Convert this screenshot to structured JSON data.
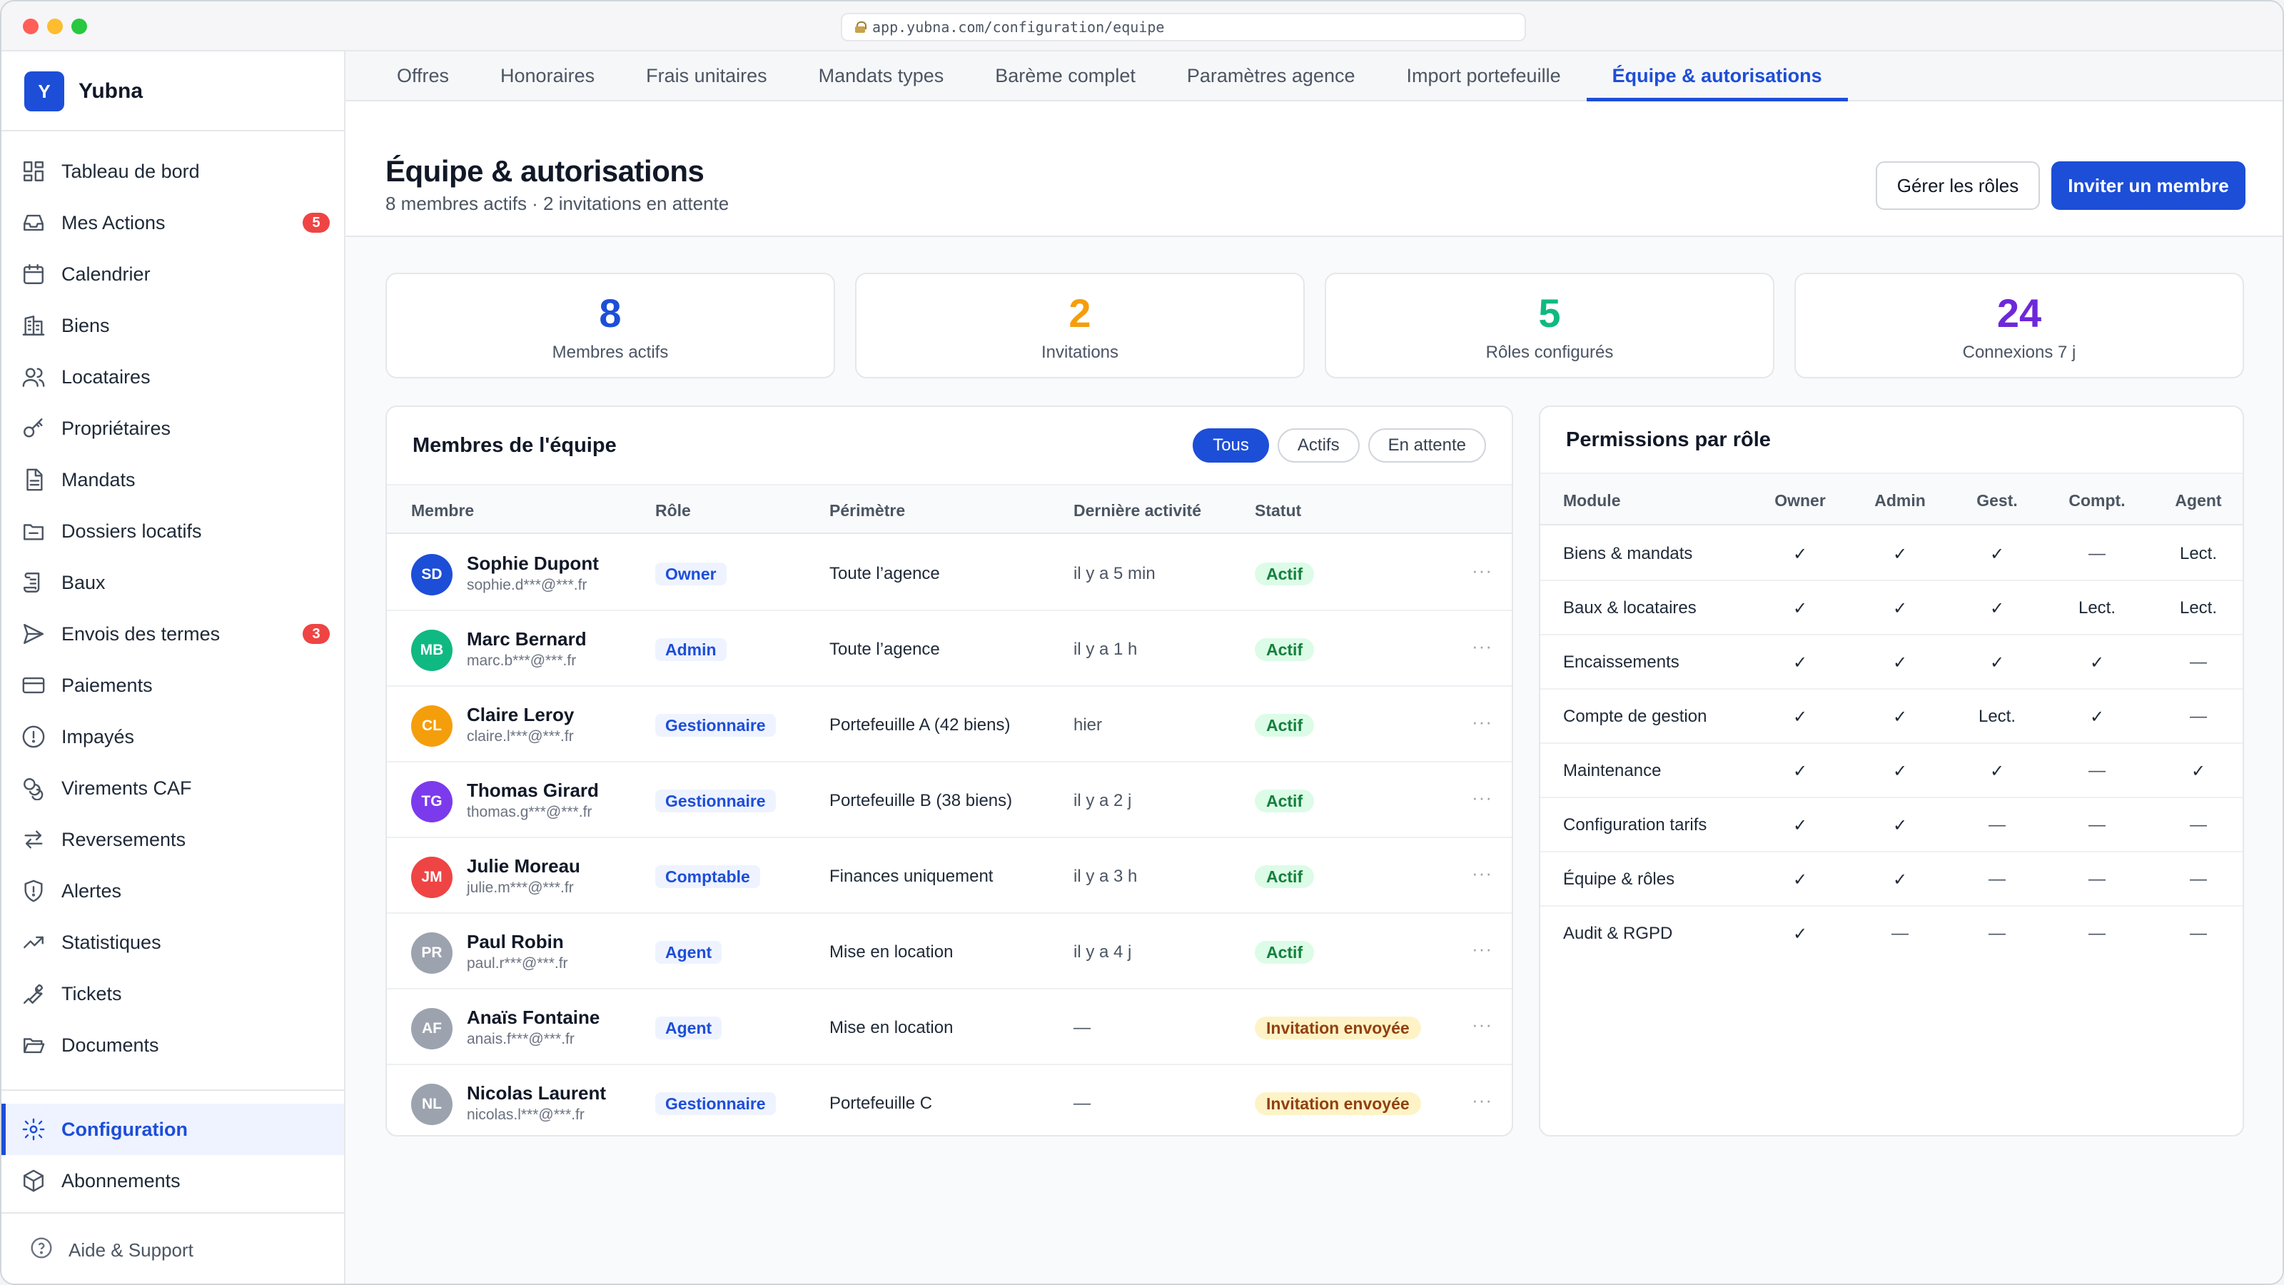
{
  "browser": {
    "url": "app.yubna.com/configuration/equipe"
  },
  "brand": {
    "logo_letter": "Y",
    "name": "Yubna"
  },
  "sidebar": {
    "items": [
      {
        "label": "Tableau de bord",
        "icon": "dashboard-icon"
      },
      {
        "label": "Mes Actions",
        "icon": "inbox-icon",
        "badge": "5"
      },
      {
        "label": "Calendrier",
        "icon": "calendar-icon"
      },
      {
        "label": "Biens",
        "icon": "building-icon"
      },
      {
        "label": "Locataires",
        "icon": "users-icon"
      },
      {
        "label": "Propriétaires",
        "icon": "key-icon"
      },
      {
        "label": "Mandats",
        "icon": "document-icon"
      },
      {
        "label": "Dossiers locatifs",
        "icon": "folder-icon"
      },
      {
        "label": "Baux",
        "icon": "scroll-icon"
      },
      {
        "label": "Envois des termes",
        "icon": "send-icon",
        "badge": "3"
      },
      {
        "label": "Paiements",
        "icon": "credit-card-icon"
      },
      {
        "label": "Impayés",
        "icon": "alert-circle-icon"
      },
      {
        "label": "Virements CAF",
        "icon": "coins-icon"
      },
      {
        "label": "Reversements",
        "icon": "arrows-icon"
      },
      {
        "label": "Alertes",
        "icon": "shield-icon"
      },
      {
        "label": "Statistiques",
        "icon": "trend-icon"
      },
      {
        "label": "Tickets",
        "icon": "wrench-icon"
      },
      {
        "label": "Documents",
        "icon": "folder-open-icon"
      }
    ],
    "bottom_items": [
      {
        "label": "Configuration",
        "icon": "gear-icon",
        "active": true
      },
      {
        "label": "Abonnements",
        "icon": "box-icon"
      }
    ],
    "help": "Aide & Support"
  },
  "tabs": [
    {
      "label": "Offres"
    },
    {
      "label": "Honoraires"
    },
    {
      "label": "Frais unitaires"
    },
    {
      "label": "Mandats types"
    },
    {
      "label": "Barème complet"
    },
    {
      "label": "Paramètres agence"
    },
    {
      "label": "Import portefeuille"
    },
    {
      "label": "Équipe & autorisations",
      "active": true
    }
  ],
  "header": {
    "title": "Équipe & autorisations",
    "subtitle": "8 membres actifs · 2 invitations en attente",
    "manage_roles_label": "Gérer les rôles",
    "invite_label": "Inviter un membre"
  },
  "stats": [
    {
      "value": "8",
      "label": "Membres actifs",
      "color": "#1d4ed8"
    },
    {
      "value": "2",
      "label": "Invitations",
      "color": "#f59e0b"
    },
    {
      "value": "5",
      "label": "Rôles configurés",
      "color": "#10b981"
    },
    {
      "value": "24",
      "label": "Connexions 7 j",
      "color": "#6d28d9"
    }
  ],
  "members": {
    "title": "Membres de l'équipe",
    "filters": [
      "Tous",
      "Actifs",
      "En attente"
    ],
    "columns": [
      "Membre",
      "Rôle",
      "Périmètre",
      "Dernière activité",
      "Statut"
    ],
    "rows": [
      {
        "initials": "SD",
        "color": "#1d4ed8",
        "name": "Sophie Dupont",
        "email": "sophie.d***@***.fr",
        "role": "Owner",
        "scope": "Toute l’agence",
        "activity": "il y a 5 min",
        "status": "Actif",
        "status_kind": "ok"
      },
      {
        "initials": "MB",
        "color": "#10b981",
        "name": "Marc Bernard",
        "email": "marc.b***@***.fr",
        "role": "Admin",
        "scope": "Toute l’agence",
        "activity": "il y a 1 h",
        "status": "Actif",
        "status_kind": "ok"
      },
      {
        "initials": "CL",
        "color": "#f59e0b",
        "name": "Claire Leroy",
        "email": "claire.l***@***.fr",
        "role": "Gestionnaire",
        "scope": "Portefeuille A (42 biens)",
        "activity": "hier",
        "status": "Actif",
        "status_kind": "ok"
      },
      {
        "initials": "TG",
        "color": "#7c3aed",
        "name": "Thomas Girard",
        "email": "thomas.g***@***.fr",
        "role": "Gestionnaire",
        "scope": "Portefeuille B (38 biens)",
        "activity": "il y a 2 j",
        "status": "Actif",
        "status_kind": "ok"
      },
      {
        "initials": "JM",
        "color": "#ef4444",
        "name": "Julie Moreau",
        "email": "julie.m***@***.fr",
        "role": "Comptable",
        "scope": "Finances uniquement",
        "activity": "il y a 3 h",
        "status": "Actif",
        "status_kind": "ok"
      },
      {
        "initials": "PR",
        "color": "#9ca3af",
        "name": "Paul Robin",
        "email": "paul.r***@***.fr",
        "role": "Agent",
        "scope": "Mise en location",
        "activity": "il y a 4 j",
        "status": "Actif",
        "status_kind": "ok"
      },
      {
        "initials": "AF",
        "color": "#9ca3af",
        "name": "Anaïs Fontaine",
        "email": "anais.f***@***.fr",
        "role": "Agent",
        "scope": "Mise en location",
        "activity": "—",
        "status": "Invitation envoyée",
        "status_kind": "wait"
      },
      {
        "initials": "NL",
        "color": "#9ca3af",
        "name": "Nicolas Laurent",
        "email": "nicolas.l***@***.fr",
        "role": "Gestionnaire",
        "scope": "Portefeuille C",
        "activity": "—",
        "status": "Invitation envoyée",
        "status_kind": "wait"
      }
    ]
  },
  "permissions": {
    "title": "Permissions par rôle",
    "columns": [
      "Module",
      "Owner",
      "Admin",
      "Gest.",
      "Compt.",
      "Agent"
    ],
    "rows": [
      {
        "module": "Biens & mandats",
        "values": [
          "✓",
          "✓",
          "✓",
          "—",
          "Lect."
        ]
      },
      {
        "module": "Baux & locataires",
        "values": [
          "✓",
          "✓",
          "✓",
          "Lect.",
          "Lect."
        ]
      },
      {
        "module": "Encaissements",
        "values": [
          "✓",
          "✓",
          "✓",
          "✓",
          "—"
        ]
      },
      {
        "module": "Compte de gestion",
        "values": [
          "✓",
          "✓",
          "Lect.",
          "✓",
          "—"
        ]
      },
      {
        "module": "Maintenance",
        "values": [
          "✓",
          "✓",
          "✓",
          "—",
          "✓"
        ]
      },
      {
        "module": "Configuration tarifs",
        "values": [
          "✓",
          "✓",
          "—",
          "—",
          "—"
        ]
      },
      {
        "module": "Équipe & rôles",
        "values": [
          "✓",
          "✓",
          "—",
          "—",
          "—"
        ]
      },
      {
        "module": "Audit & RGPD",
        "values": [
          "✓",
          "—",
          "—",
          "—",
          "—"
        ]
      }
    ]
  }
}
